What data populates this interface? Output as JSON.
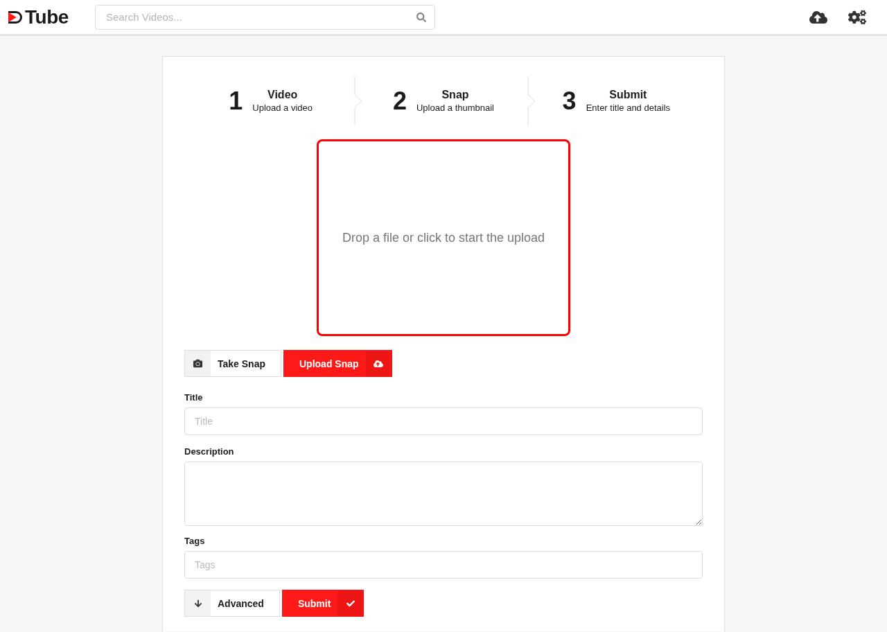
{
  "header": {
    "logo_text": "Tube",
    "search": {
      "placeholder": "Search Videos..."
    }
  },
  "steps": [
    {
      "number": "1",
      "title": "Video",
      "subtitle": "Upload a video"
    },
    {
      "number": "2",
      "title": "Snap",
      "subtitle": "Upload a thumbnail"
    },
    {
      "number": "3",
      "title": "Submit",
      "subtitle": "Enter title and details"
    }
  ],
  "dropzone": {
    "text": "Drop a file or click to start the upload"
  },
  "snap_buttons": [
    {
      "label": "Take Snap",
      "kind": "secondary"
    },
    {
      "label": "Upload Snap",
      "kind": "primary"
    }
  ],
  "fields": [
    {
      "label": "Title",
      "kind": "input",
      "placeholder": "Title"
    },
    {
      "label": "Description",
      "kind": "textarea"
    },
    {
      "label": "Tags",
      "kind": "input",
      "placeholder": "Tags"
    }
  ],
  "action_buttons": [
    {
      "label": "Advanced",
      "kind": "secondary"
    },
    {
      "label": "Submit",
      "kind": "primary"
    }
  ]
}
